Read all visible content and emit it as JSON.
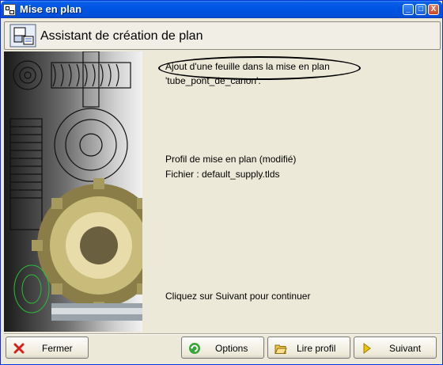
{
  "window": {
    "title": "Mise en plan"
  },
  "header": {
    "title": "Assistant de création de plan"
  },
  "content": {
    "line1": "Ajout d'une feuille dans la mise en plan",
    "line2": "'tube_pont_de_canon'.",
    "profile_line": "Profil de mise en plan  (modifié)",
    "file_line": "Fichier : default_supply.tlds",
    "instruction": "Cliquez sur Suivant pour continuer"
  },
  "buttons": {
    "close": "Fermer",
    "options": "Options",
    "read_profile": "Lire profil",
    "next": "Suivant"
  },
  "titlebar_buttons": {
    "minimize": "_",
    "maximize": "□",
    "close": "X"
  },
  "icons": {
    "window": "drawing-app-icon",
    "header": "drawing-wizard-icon",
    "close_button": "red-x-icon",
    "options_button": "green-refresh-icon",
    "read_profile_button": "open-folder-icon",
    "next_button": "yellow-arrow-icon"
  }
}
